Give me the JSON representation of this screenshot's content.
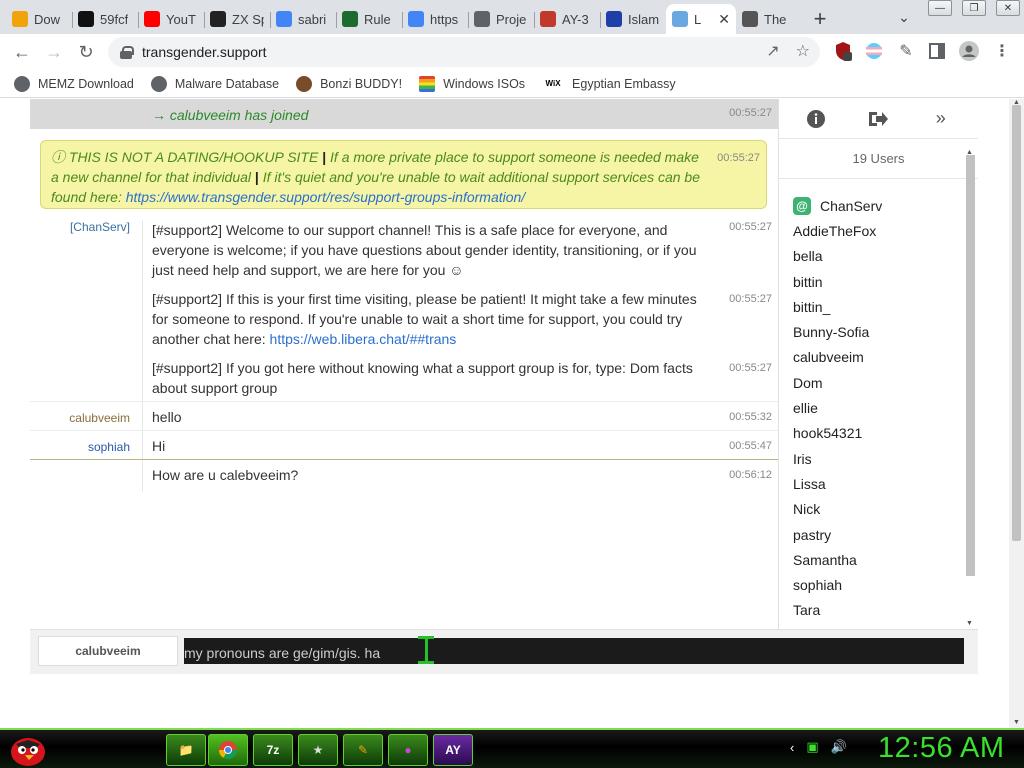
{
  "tabs": [
    {
      "title": "Dow",
      "favicon": "pen-icon",
      "color": "#f0a30a"
    },
    {
      "title": "59fcf",
      "favicon": "b-icon",
      "color": "#111111"
    },
    {
      "title": "YouT",
      "favicon": "youtube-icon",
      "color": "#ff0000"
    },
    {
      "title": "ZX Sp",
      "favicon": "zx-icon",
      "color": "#222222"
    },
    {
      "title": "sabri",
      "favicon": "google-icon",
      "color": "#4285f4"
    },
    {
      "title": "Rule",
      "favicon": "pcb-icon",
      "color": "#1e6b2e"
    },
    {
      "title": "https",
      "favicon": "google-icon",
      "color": "#4285f4"
    },
    {
      "title": "Proje",
      "favicon": "globe-icon",
      "color": "#5f6368"
    },
    {
      "title": "AY-3",
      "favicon": "music-icon",
      "color": "#c0392b"
    },
    {
      "title": "Islam",
      "favicon": "ir-icon",
      "color": "#1f3fa8"
    },
    {
      "title": "L",
      "favicon": "chat-icon",
      "color": "#6aa8e0",
      "active": true
    },
    {
      "title": "The",
      "favicon": "book-icon",
      "color": "#555555"
    }
  ],
  "address": "transgender.support",
  "bookmarks": [
    {
      "label": "MEMZ Download",
      "icon": "globe-icon"
    },
    {
      "label": "Malware Database",
      "icon": "globe-icon"
    },
    {
      "label": "Bonzi BUDDY!",
      "icon": "bonzi-icon"
    },
    {
      "label": "Windows ISOs",
      "icon": "windows-icon"
    },
    {
      "label": "Egyptian Embassy",
      "icon": "wix-icon",
      "icon_text": "WiX"
    }
  ],
  "ext_badge": "4",
  "chat": {
    "join": {
      "text": "→ calubveeim has joined",
      "time": "00:55:27"
    },
    "notice": {
      "caps": "ⓘ THIS IS NOT A DATING/HOOKUP SITE",
      "sep": "|",
      "part1": "If a more private place to support someone is needed make a new channel for that individual",
      "part2": "If it's quiet and you're unable to wait additional support services can be found here:",
      "link": "https://www.transgender.support/res/support-groups-information/",
      "time": "00:55:27"
    },
    "messages": [
      {
        "nick": "[ChanServ]",
        "text": "[#support2] Welcome to our support channel! This is a safe place for everyone, and everyone is welcome; if you have questions about gender identity, transitioning, or if you just need help and support, we are here for you ☺",
        "time": "00:55:27",
        "color": "#3a6fa0"
      },
      {
        "nick": "",
        "text": "[#support2] If this is your first time visiting, please be patient! It might take a few minutes for someone to respond. If you're unable to wait a short time for support, you could try another chat here:",
        "link": "https://web.libera.chat/##trans",
        "time": "00:55:27"
      },
      {
        "nick": "",
        "text": "[#support2] If you got here without knowing what a support group is for, type: Dom facts about support group",
        "time": "00:55:27"
      },
      {
        "nick": "calubveeim",
        "text": "hello",
        "time": "00:55:32",
        "color": "#8a6d3b"
      },
      {
        "nick": "sophiah",
        "text": "Hi",
        "time": "00:55:47",
        "color": "#2a58a8"
      },
      {
        "nick": "",
        "text": "How are u calebveeim?",
        "time": "00:56:12"
      }
    ]
  },
  "users": {
    "count_label": "19 Users",
    "list": [
      "ChanServ",
      "AddieTheFox",
      "bella",
      "bittin",
      "bittin_",
      "Bunny-Sofia",
      "calubveeim",
      "Dom",
      "ellie",
      "hook54321",
      "Iris",
      "Lissa",
      "Nick",
      "pastry",
      "Samantha",
      "sophiah",
      "Tara"
    ],
    "op_badge": "@"
  },
  "input": {
    "nick": "calubveeim",
    "value": "my pronouns are ge/gim/gis. ha"
  },
  "clock": "12:56 AM"
}
